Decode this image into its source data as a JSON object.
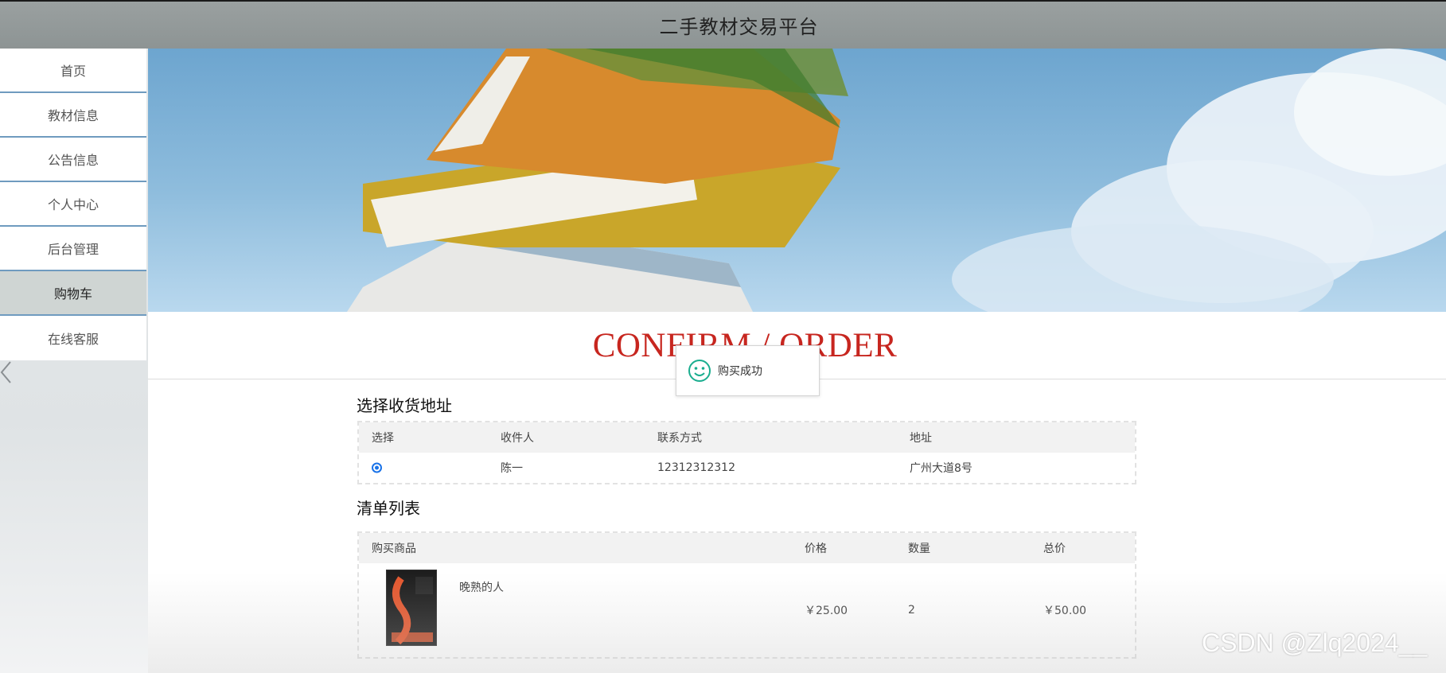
{
  "header": {
    "title": "二手教材交易平台"
  },
  "sidebar": {
    "items": [
      {
        "label": "首页"
      },
      {
        "label": "教材信息"
      },
      {
        "label": "公告信息"
      },
      {
        "label": "个人中心"
      },
      {
        "label": "后台管理"
      },
      {
        "label": "购物车",
        "active": true
      },
      {
        "label": "在线客服"
      }
    ]
  },
  "main": {
    "heading": "CONFIRM / ORDER",
    "toast": {
      "icon": "smile-icon",
      "message": "购买成功"
    },
    "address_section": {
      "title": "选择收货地址",
      "columns": [
        "选择",
        "收件人",
        "联系方式",
        "地址"
      ],
      "rows": [
        {
          "selected": true,
          "recipient": "陈一",
          "phone": "12312312312",
          "address": "广州大道8号"
        }
      ]
    },
    "items_section": {
      "title": "清单列表",
      "columns": [
        "购买商品",
        "价格",
        "数量",
        "总价"
      ],
      "rows": [
        {
          "name": "晚熟的人",
          "price": "￥25.00",
          "quantity": "2",
          "total": "￥50.00"
        }
      ]
    }
  },
  "watermark": "CSDN @Zlq2024__",
  "colors": {
    "accent_red": "#c7261f",
    "nav_border": "#6f9bbf",
    "toast_icon": "#1aad8f"
  }
}
